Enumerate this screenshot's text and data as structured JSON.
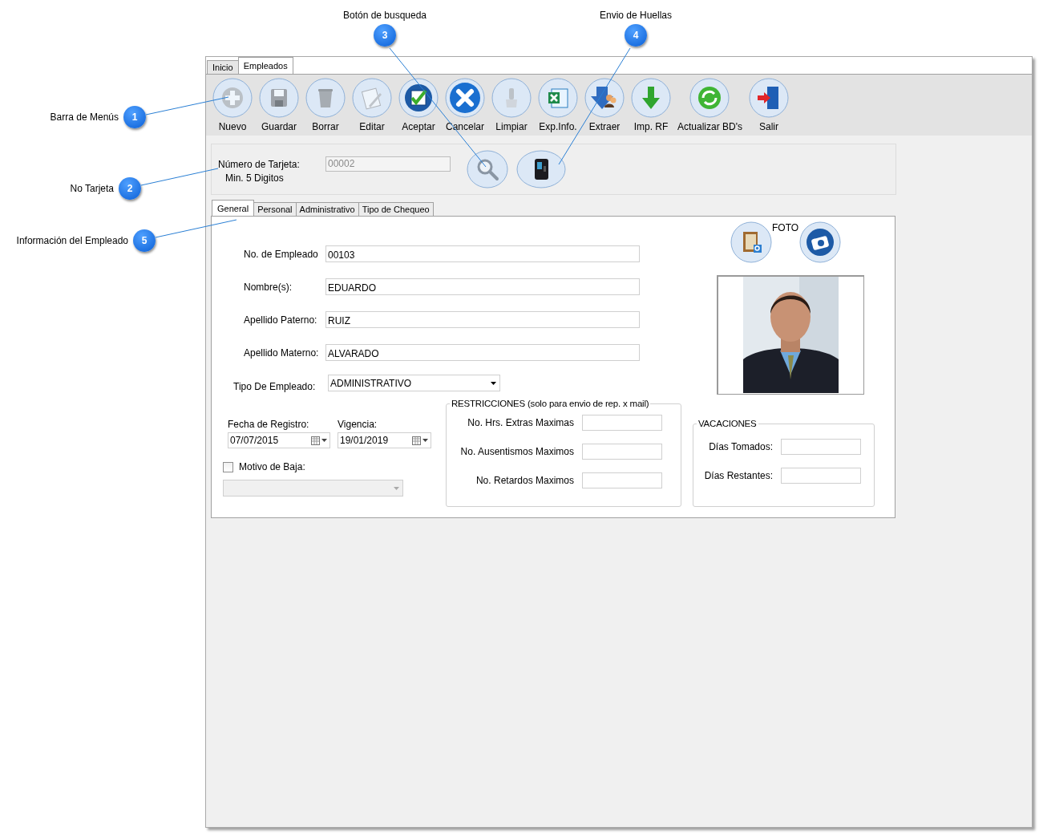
{
  "callouts": [
    {
      "number": "1",
      "label": "Barra de Menús",
      "kind": "left"
    },
    {
      "number": "2",
      "label": "No Tarjeta",
      "kind": "left"
    },
    {
      "number": "3",
      "label": "Botón de busqueda",
      "kind": "top"
    },
    {
      "number": "4",
      "label": "Envio de Huellas",
      "kind": "top"
    },
    {
      "number": "5",
      "label": "Información del Empleado",
      "kind": "left"
    }
  ],
  "tabs": [
    {
      "label": "Inicio",
      "selected": false
    },
    {
      "label": "Empleados",
      "selected": true
    }
  ],
  "toolbar": [
    {
      "label": "Nuevo",
      "kind": "plus",
      "disabled": true
    },
    {
      "label": "Guardar",
      "kind": "disk",
      "disabled": true
    },
    {
      "label": "Borrar",
      "kind": "trash",
      "disabled": true
    },
    {
      "label": "Editar",
      "kind": "notepad",
      "disabled": true
    },
    {
      "label": "Aceptar",
      "kind": "check",
      "disabled": false
    },
    {
      "label": "Cancelar",
      "kind": "cross",
      "disabled": false
    },
    {
      "label": "Limpiar",
      "kind": "brush",
      "disabled": true
    },
    {
      "label": "Exp.Info.",
      "kind": "sheet",
      "disabled": false
    },
    {
      "label": "Extraer",
      "kind": "people",
      "disabled": false
    },
    {
      "label": "Imp. RF",
      "kind": "arrow",
      "disabled": false
    },
    {
      "label": "Actualizar BD's",
      "kind": "refresh",
      "disabled": false
    },
    {
      "label": "Salir",
      "kind": "door",
      "disabled": false
    }
  ],
  "card": {
    "label": "Número de Tarjeta:",
    "hint": "Min. 5 Digitos",
    "value": "00002",
    "disabled": true,
    "buttons": [
      {
        "kind": "search"
      },
      {
        "kind": "device"
      }
    ]
  },
  "subtabs": [
    {
      "label": "General",
      "selected": true
    },
    {
      "label": "Personal",
      "selected": false
    },
    {
      "label": "Administrativo",
      "selected": false
    },
    {
      "label": "Tipo de Chequeo",
      "selected": false
    }
  ],
  "general": {
    "photo_label": "FOTO",
    "photo_buttons": [
      {
        "kind": "contacts"
      },
      {
        "kind": "camera"
      }
    ],
    "fields": [
      {
        "label": "No. de Empleado",
        "value": "00103"
      },
      {
        "label": "Nombre(s):",
        "value": "EDUARDO"
      },
      {
        "label": "Apellido Paterno:",
        "value": "RUIZ"
      },
      {
        "label": "Apellido Materno:",
        "value": "ALVARADO"
      }
    ],
    "tipo": {
      "label": "Tipo De Empleado:",
      "value": "ADMINISTRATIVO"
    },
    "dates": [
      {
        "label": "Fecha de Registro:",
        "value": "07/07/2015"
      },
      {
        "label": "Vigencia:",
        "value": "19/01/2019"
      }
    ],
    "motivo": {
      "label": "Motivo de Baja:",
      "checked": false
    },
    "restricciones": {
      "title": "RESTRICCIONES (solo para envio de rep. x mail)",
      "fields": [
        {
          "label": "No. Hrs. Extras Maximas"
        },
        {
          "label": "No. Ausentismos Maximos"
        },
        {
          "label": "No. Retardos Maximos"
        }
      ]
    },
    "vacaciones": {
      "title": "VACACIONES",
      "fields": [
        {
          "label": "Días Tomados:"
        },
        {
          "label": "Días Restantes:"
        }
      ]
    }
  }
}
